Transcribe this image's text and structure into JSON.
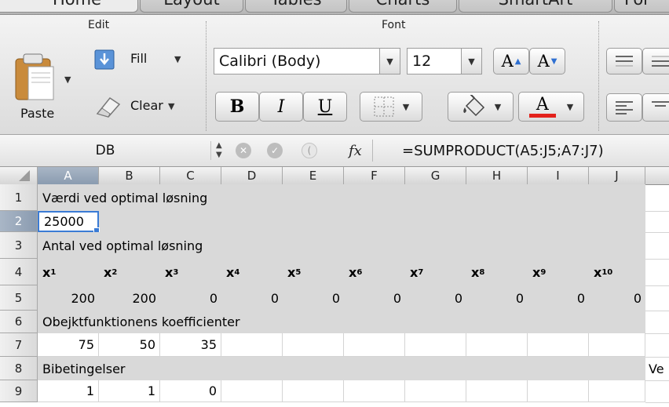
{
  "tabs": [
    "Home",
    "Layout",
    "Tables",
    "Charts",
    "SmartArt",
    "For"
  ],
  "ribbon": {
    "edit": {
      "title": "Edit",
      "paste": "Paste",
      "fill": "Fill",
      "clear": "Clear"
    },
    "font": {
      "title": "Font",
      "family": "Calibri (Body)",
      "size": "12",
      "bold": "B",
      "italic": "I",
      "underline": "U",
      "grow": "A",
      "shrink": "A",
      "color": "A"
    },
    "accent_red": "#e3211b"
  },
  "formula_bar": {
    "name_box": "DB",
    "fx": "fx",
    "formula": "=SUMPRODUCT(A5:J5;A7:J7)"
  },
  "grid": {
    "columns": [
      "A",
      "B",
      "C",
      "D",
      "E",
      "F",
      "G",
      "H",
      "I",
      "J"
    ],
    "selected_column": "A",
    "selected_row": "2",
    "rows": [
      {
        "n": "1",
        "text": "Værdi ved optimal løsning"
      },
      {
        "n": "2",
        "value": "25000"
      },
      {
        "n": "3",
        "text": "Antal ved optimal løsning"
      },
      {
        "n": "4",
        "var": "x",
        "subs": [
          "1",
          "2",
          "3",
          "4",
          "5",
          "6",
          "7",
          "8",
          "9",
          "10"
        ]
      },
      {
        "n": "5",
        "values": [
          "200",
          "200",
          "0",
          "0",
          "0",
          "0",
          "0",
          "0",
          "0",
          "0"
        ]
      },
      {
        "n": "6",
        "text": "Obejktfunktionens koefficienter"
      },
      {
        "n": "7",
        "values": [
          "75",
          "50",
          "35"
        ]
      },
      {
        "n": "8",
        "text": "Bibetingelser",
        "right_text": "Ve"
      },
      {
        "n": "9",
        "values": [
          "1",
          "1",
          "0"
        ]
      }
    ]
  }
}
